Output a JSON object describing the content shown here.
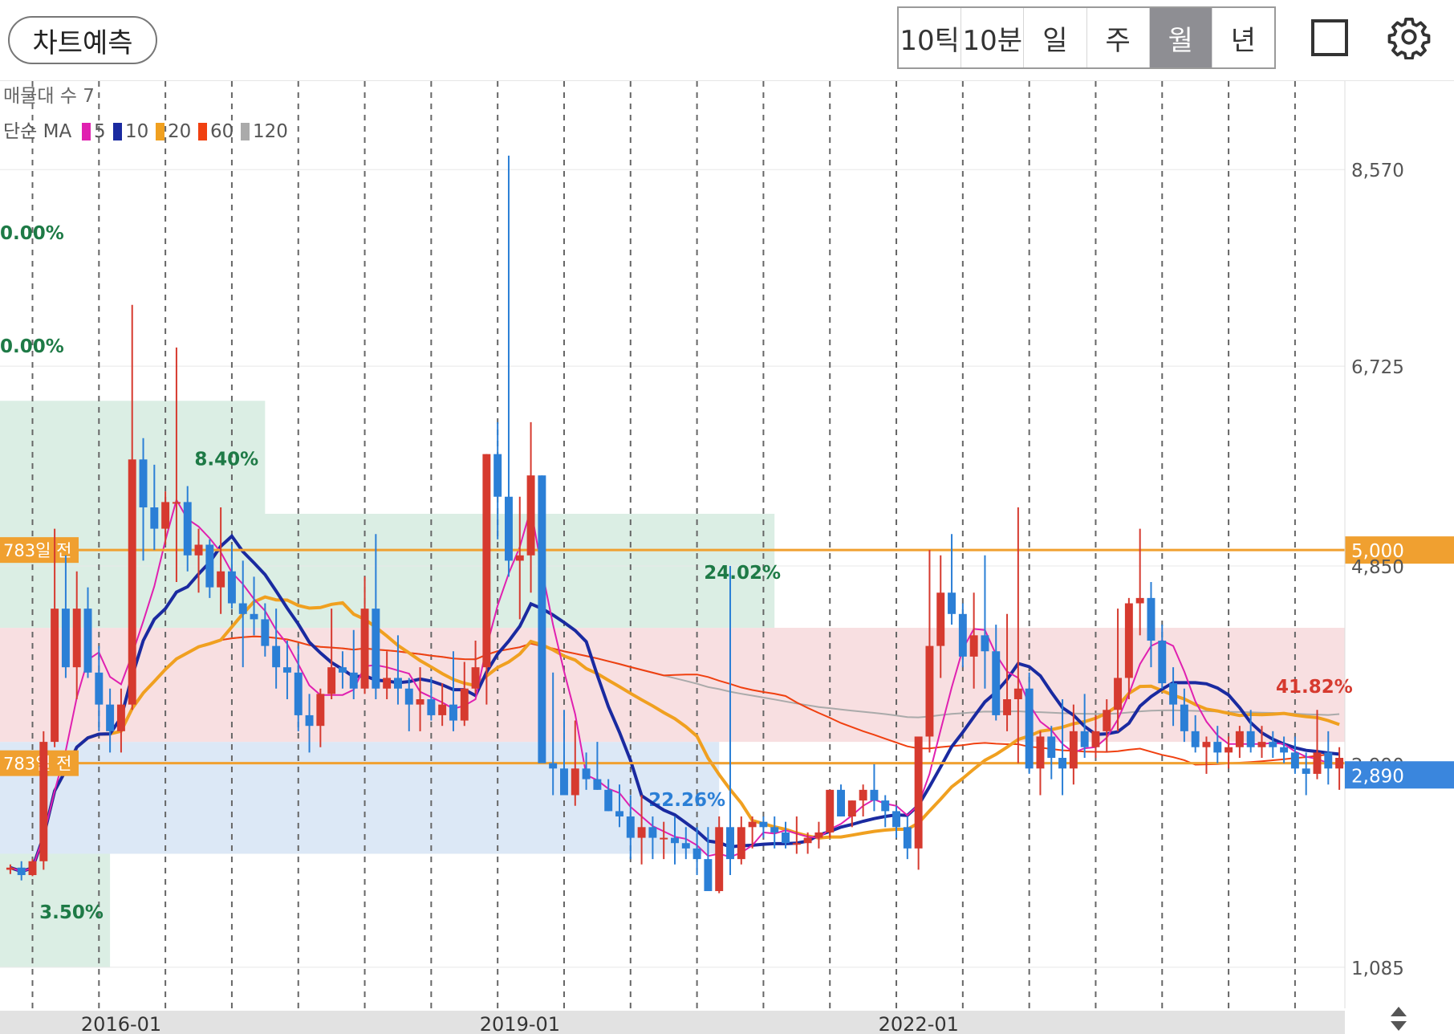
{
  "toolbar": {
    "predict_label": "차트예측",
    "periods": [
      "10틱",
      "10분",
      "일",
      "주",
      "월",
      "년"
    ],
    "active_period": "월",
    "icons": [
      "square-icon",
      "gear-icon"
    ]
  },
  "legend": {
    "volume_profile_label": "매물대 수 7",
    "ma_prefix": "단순 MA",
    "ma_items": [
      {
        "period": "5",
        "color": "#e020b0"
      },
      {
        "period": "10",
        "color": "#1a2aa0"
      },
      {
        "period": "20",
        "color": "#f0a020"
      },
      {
        "period": "60",
        "color": "#f04010"
      },
      {
        "period": "120",
        "color": "#aaaaaa"
      }
    ]
  },
  "colors": {
    "up": "#d63a2f",
    "down": "#2b7fd6",
    "ref_line": "#f0a030",
    "current_tag": "#3a86dd"
  },
  "chart_data": {
    "type": "candlestick",
    "y_axis_ticks": [
      {
        "value": 8570,
        "label": "8,570"
      },
      {
        "value": 6725,
        "label": "6,725"
      },
      {
        "value": 4850,
        "label": "4,850"
      },
      {
        "value": 2990,
        "label": "2,990"
      },
      {
        "value": 1085,
        "label": "1,085"
      }
    ],
    "x_axis_labels": [
      {
        "date": "2016-01",
        "index": 10
      },
      {
        "date": "2019-01",
        "index": 46
      },
      {
        "date": "2022-01",
        "index": 82
      }
    ],
    "ylim": [
      700,
      9400
    ],
    "grid": "vertical-dashed",
    "ref_lines": [
      {
        "value": 5000,
        "label": "783일 전",
        "price_label": "5,000"
      },
      {
        "value": 3000,
        "label": "783일 전"
      }
    ],
    "current_price": {
      "value": 2890,
      "label": "2,890"
    },
    "volume_profile_zones": [
      {
        "low": 1085,
        "high": 2150,
        "end_index": 9,
        "color": "#dbeee4",
        "pct": "3.50%",
        "pct_color": "#1e7a46"
      },
      {
        "low": 2150,
        "high": 3200,
        "end_index": 64,
        "color": "#dce8f6",
        "pct": "22.26%",
        "pct_color": "#2b7fd6"
      },
      {
        "low": 3200,
        "high": 4270,
        "end_index": 121,
        "color": "#f8dfe1",
        "pct": "41.82%",
        "pct_color": "#d63a2f"
      },
      {
        "low": 4270,
        "high": 5340,
        "end_index": 69,
        "color": "#dbeee4",
        "pct": "24.02%",
        "pct_color": "#1e7a46"
      },
      {
        "low": 5340,
        "high": 6400,
        "end_index": 23,
        "color": "#dbeee4",
        "pct": "8.40%",
        "pct_color": "#1e7a46"
      },
      {
        "low": 6400,
        "high": 7460,
        "end_index": 0,
        "color": "#dbeee4",
        "pct": "0.00%",
        "pct_color": "#1e7a46"
      },
      {
        "low": 7460,
        "high": 8520,
        "end_index": 0,
        "color": "#dbeee4",
        "pct": "0.00%",
        "pct_color": "#1e7a46"
      }
    ],
    "candles": [
      [
        2000,
        2050,
        1960,
        2020
      ],
      [
        2020,
        2080,
        1900,
        1950
      ],
      [
        1950,
        2100,
        1940,
        2080
      ],
      [
        2080,
        3300,
        2000,
        3200
      ],
      [
        3200,
        5200,
        3150,
        4450
      ],
      [
        4450,
        4950,
        3800,
        3900
      ],
      [
        3900,
        4800,
        3600,
        4450
      ],
      [
        4450,
        4650,
        3800,
        3850
      ],
      [
        3850,
        4100,
        3300,
        3550
      ],
      [
        3550,
        3700,
        3100,
        3300
      ],
      [
        3300,
        3700,
        3100,
        3550
      ],
      [
        3550,
        7300,
        3500,
        5850
      ],
      [
        5850,
        6050,
        4900,
        5400
      ],
      [
        5400,
        5800,
        5000,
        5200
      ],
      [
        5200,
        5550,
        5050,
        5450
      ],
      [
        5450,
        6900,
        4700,
        5450
      ],
      [
        5450,
        5600,
        4800,
        4950
      ],
      [
        4950,
        5200,
        4600,
        5050
      ],
      [
        5050,
        5100,
        4550,
        4650
      ],
      [
        4650,
        5400,
        4400,
        4800
      ],
      [
        4800,
        5050,
        4450,
        4500
      ],
      [
        4500,
        4900,
        3900,
        4400
      ],
      [
        4400,
        4750,
        4200,
        4350
      ],
      [
        4350,
        4500,
        4000,
        4100
      ],
      [
        4100,
        4450,
        3700,
        3900
      ],
      [
        3900,
        4150,
        3600,
        3850
      ],
      [
        3850,
        4100,
        3300,
        3450
      ],
      [
        3450,
        3650,
        3100,
        3350
      ],
      [
        3350,
        3700,
        3150,
        3650
      ],
      [
        3650,
        4450,
        3600,
        3900
      ],
      [
        3900,
        4050,
        3700,
        3850
      ],
      [
        3850,
        4250,
        3600,
        3700
      ],
      [
        3700,
        4750,
        3650,
        4450
      ],
      [
        4450,
        5150,
        3600,
        3700
      ],
      [
        3700,
        4050,
        3600,
        3800
      ],
      [
        3800,
        4200,
        3550,
        3700
      ],
      [
        3700,
        3800,
        3300,
        3550
      ],
      [
        3550,
        3900,
        3300,
        3600
      ],
      [
        3600,
        3800,
        3400,
        3450
      ],
      [
        3450,
        3750,
        3350,
        3550
      ],
      [
        3550,
        4050,
        3300,
        3400
      ],
      [
        3400,
        3950,
        3350,
        3700
      ],
      [
        3700,
        4150,
        3650,
        3900
      ],
      [
        3900,
        5900,
        3550,
        5900
      ],
      [
        5900,
        6200,
        5100,
        5500
      ],
      [
        5500,
        8700,
        4750,
        4900
      ],
      [
        4900,
        5500,
        4350,
        4950
      ],
      [
        4950,
        6200,
        4600,
        5700
      ],
      [
        5700,
        5700,
        3500,
        3000
      ],
      [
        3000,
        3850,
        2700,
        2950
      ],
      [
        2950,
        3500,
        2800,
        2700
      ],
      [
        2700,
        3400,
        2600,
        2950
      ],
      [
        2950,
        3100,
        2750,
        2850
      ],
      [
        2850,
        3200,
        2750,
        2750
      ],
      [
        2750,
        2850,
        2550,
        2550
      ],
      [
        2550,
        2800,
        2400,
        2500
      ],
      [
        2500,
        2700,
        2100,
        2300
      ],
      [
        2300,
        2700,
        2050,
        2400
      ],
      [
        2400,
        2500,
        2100,
        2300
      ],
      [
        2300,
        2450,
        2100,
        2300
      ],
      [
        2300,
        2500,
        2050,
        2250
      ],
      [
        2250,
        2400,
        2100,
        2200
      ],
      [
        2200,
        2400,
        1950,
        2100
      ],
      [
        2100,
        2400,
        1820,
        1800
      ],
      [
        1800,
        2500,
        1780,
        2400
      ],
      [
        2400,
        4850,
        1950,
        2100
      ],
      [
        2100,
        2500,
        2050,
        2400
      ],
      [
        2400,
        2500,
        2200,
        2450
      ],
      [
        2450,
        2500,
        2300,
        2400
      ],
      [
        2400,
        2500,
        2200,
        2350
      ],
      [
        2350,
        2450,
        2200,
        2250
      ],
      [
        2250,
        2500,
        2150,
        2250
      ],
      [
        2250,
        2350,
        2150,
        2300
      ],
      [
        2300,
        2450,
        2200,
        2350
      ],
      [
        2350,
        2550,
        2300,
        2750
      ],
      [
        2750,
        2800,
        2500,
        2500
      ],
      [
        2500,
        2650,
        2400,
        2650
      ],
      [
        2650,
        2800,
        2500,
        2750
      ],
      [
        2750,
        2990,
        2550,
        2650
      ],
      [
        2650,
        2700,
        2400,
        2550
      ],
      [
        2550,
        2600,
        2300,
        2400
      ],
      [
        2400,
        2500,
        2100,
        2200
      ],
      [
        2200,
        2500,
        2000,
        3250
      ],
      [
        3250,
        5000,
        3100,
        4100
      ],
      [
        4100,
        4950,
        3800,
        4600
      ],
      [
        4600,
        5150,
        4300,
        4400
      ],
      [
        4400,
        4500,
        3900,
        4000
      ],
      [
        4000,
        4600,
        3700,
        4200
      ],
      [
        4200,
        4950,
        3700,
        4050
      ],
      [
        4050,
        4300,
        3400,
        3450
      ],
      [
        3450,
        4400,
        3300,
        3600
      ],
      [
        3600,
        5400,
        3000,
        3700
      ],
      [
        3700,
        3850,
        2900,
        2950
      ],
      [
        2950,
        3300,
        2700,
        3250
      ],
      [
        3250,
        3350,
        2850,
        3050
      ],
      [
        3050,
        3600,
        2700,
        2950
      ],
      [
        2950,
        3550,
        2800,
        3300
      ],
      [
        3300,
        3650,
        3050,
        3150
      ],
      [
        3150,
        3450,
        3050,
        3300
      ],
      [
        3300,
        3600,
        3100,
        3500
      ],
      [
        3500,
        4450,
        3300,
        3800
      ],
      [
        3800,
        4550,
        3600,
        4500
      ],
      [
        4500,
        5200,
        4200,
        4550
      ],
      [
        4550,
        4700,
        3900,
        4150
      ],
      [
        4150,
        4300,
        3700,
        3750
      ],
      [
        3750,
        3900,
        3350,
        3550
      ],
      [
        3550,
        3700,
        3200,
        3300
      ],
      [
        3300,
        3450,
        3100,
        3150
      ],
      [
        3150,
        3250,
        2900,
        3200
      ],
      [
        3200,
        3350,
        3000,
        3100
      ],
      [
        3100,
        3250,
        2950,
        3150
      ],
      [
        3150,
        3350,
        3050,
        3300
      ],
      [
        3300,
        3500,
        3100,
        3150
      ],
      [
        3150,
        3350,
        3050,
        3200
      ],
      [
        3200,
        3300,
        3050,
        3150
      ],
      [
        3150,
        3250,
        3000,
        3100
      ],
      [
        3100,
        3250,
        2900,
        2950
      ],
      [
        2950,
        3100,
        2700,
        2900
      ],
      [
        2900,
        3500,
        2850,
        3100
      ],
      [
        3100,
        3300,
        2800,
        2950
      ],
      [
        2950,
        3150,
        2750,
        3050
      ]
    ]
  }
}
